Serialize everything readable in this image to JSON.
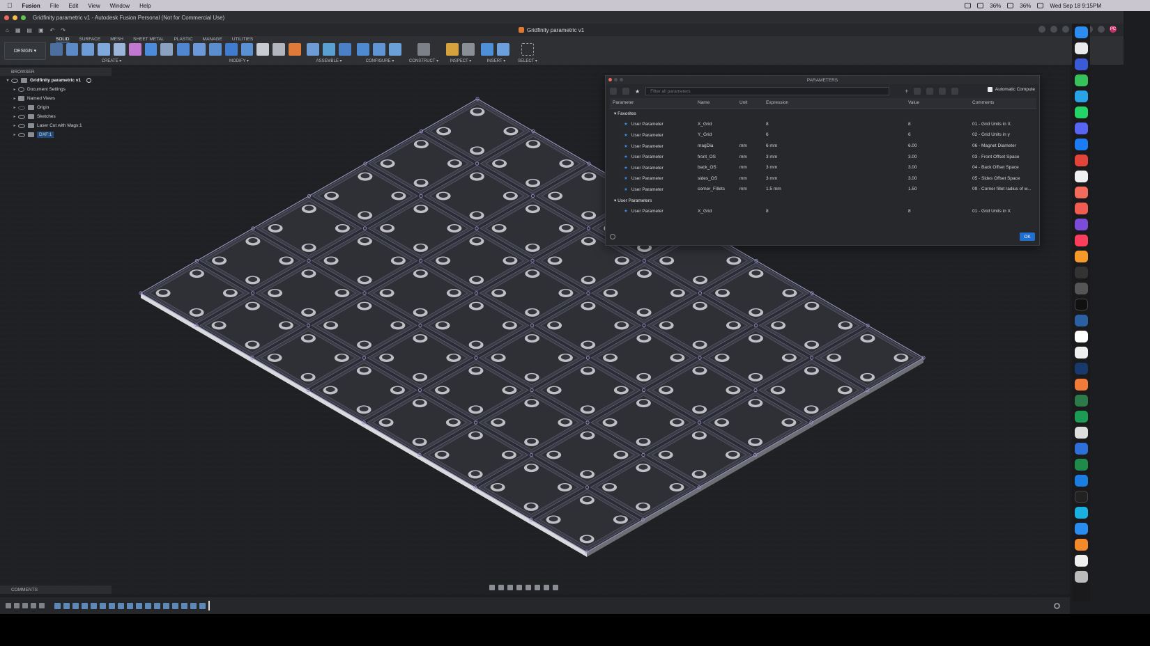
{
  "menubar": {
    "app_name": "Fusion",
    "items": [
      "File",
      "Edit",
      "View",
      "Window",
      "Help"
    ],
    "battery_1": "36%",
    "battery_2": "36%",
    "datetime": "Wed Sep 18  9:15PM"
  },
  "window": {
    "title": "Gridfinity parametric v1 - Autodesk Fusion Personal (Not for Commercial Use)",
    "doc_tab": "Gridfinity parametric v1",
    "avatar": "PC",
    "notif_count": "1"
  },
  "ribbon": {
    "workspace": "DESIGN",
    "tabs": [
      "SOLID",
      "SURFACE",
      "MESH",
      "SHEET METAL",
      "PLASTIC",
      "MANAGE",
      "UTILITIES"
    ],
    "groups": {
      "create": "CREATE",
      "modify": "MODIFY",
      "assemble": "ASSEMBLE",
      "configure": "CONFIGURE",
      "construct": "CONSTRUCT",
      "inspect": "INSPECT",
      "insert": "INSERT",
      "select": "SELECT"
    }
  },
  "browser": {
    "header": "BROWSER",
    "root": "Gridfinity parametric v1",
    "items": [
      "Document Settings",
      "Named Views",
      "Origin",
      "Sketches",
      "Laser Cut with Mags:1",
      "DXF:1"
    ]
  },
  "params": {
    "title": "PARAMETERS",
    "filter_placeholder": "Filter all parameters",
    "auto_compute": "Automatic Compute",
    "headers": [
      "Parameter",
      "Name",
      "Unit",
      "Expression",
      "Value",
      "Comments"
    ],
    "group_favorites": "Favorites",
    "group_user": "User Parameters",
    "favorites": [
      {
        "param": "User Parameter",
        "name": "X_Grid",
        "unit": "",
        "expr": "8",
        "value": "8",
        "comment": "01 - Grid Units in X"
      },
      {
        "param": "User Parameter",
        "name": "Y_Grid",
        "unit": "",
        "expr": "6",
        "value": "6",
        "comment": "02 - Grid Units in y"
      },
      {
        "param": "User Parameter",
        "name": "magDia",
        "unit": "mm",
        "expr": "6 mm",
        "value": "6.00",
        "comment": "06 - Magnet Diameter"
      },
      {
        "param": "User Parameter",
        "name": "front_OS",
        "unit": "mm",
        "expr": "3 mm",
        "value": "3.00",
        "comment": "03 - Front Offset Space"
      },
      {
        "param": "User Parameter",
        "name": "back_OS",
        "unit": "mm",
        "expr": "3 mm",
        "value": "3.00",
        "comment": "04 - Back Offset Space"
      },
      {
        "param": "User Parameter",
        "name": "sides_OS",
        "unit": "mm",
        "expr": "3 mm",
        "value": "3.00",
        "comment": "05 - Sides Offset Space"
      },
      {
        "param": "User Parameter",
        "name": "corner_Fillets",
        "unit": "mm",
        "expr": "1.5 mm",
        "value": "1.50",
        "comment": "09 - Corner fillet radius of w..."
      }
    ],
    "user": [
      {
        "param": "User Parameter",
        "name": "X_Grid",
        "unit": "",
        "expr": "8",
        "value": "8",
        "comment": "01 - Grid Units in X"
      }
    ],
    "ok_label": "OK"
  },
  "comments": {
    "label": "COMMENTS"
  },
  "grid_model": {
    "cols": 8,
    "rows": 6
  },
  "colors": {
    "accent": "#1e6fd0",
    "star": "#3d8ae0",
    "viewport_bg": "#1f2023"
  }
}
